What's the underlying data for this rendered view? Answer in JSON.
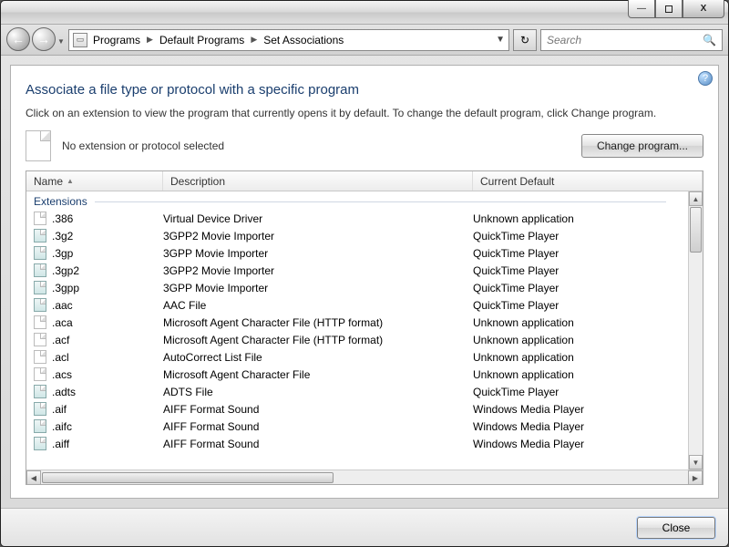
{
  "titlebar": {
    "min": "—",
    "max": "",
    "close": "X"
  },
  "nav": {
    "crumbs": [
      "Programs",
      "Default Programs",
      "Set Associations"
    ],
    "search_placeholder": "Search"
  },
  "page": {
    "heading": "Associate a file type or protocol with a specific program",
    "instruction": "Click on an extension to view the program that currently opens it by default. To change the default program, click Change program.",
    "no_selection": "No extension or protocol selected",
    "change_btn": "Change program...",
    "help": "?"
  },
  "columns": {
    "name": "Name",
    "desc": "Description",
    "def": "Current Default"
  },
  "group_label": "Extensions",
  "rows": [
    {
      "ext": ".386",
      "desc": "Virtual Device Driver",
      "def": "Unknown application",
      "media": false
    },
    {
      "ext": ".3g2",
      "desc": "3GPP2 Movie Importer",
      "def": "QuickTime Player",
      "media": true
    },
    {
      "ext": ".3gp",
      "desc": "3GPP Movie Importer",
      "def": "QuickTime Player",
      "media": true
    },
    {
      "ext": ".3gp2",
      "desc": "3GPP2 Movie Importer",
      "def": "QuickTime Player",
      "media": true
    },
    {
      "ext": ".3gpp",
      "desc": "3GPP Movie Importer",
      "def": "QuickTime Player",
      "media": true
    },
    {
      "ext": ".aac",
      "desc": "AAC File",
      "def": "QuickTime Player",
      "media": true
    },
    {
      "ext": ".aca",
      "desc": "Microsoft Agent Character File (HTTP format)",
      "def": "Unknown application",
      "media": false
    },
    {
      "ext": ".acf",
      "desc": "Microsoft Agent Character File (HTTP format)",
      "def": "Unknown application",
      "media": false
    },
    {
      "ext": ".acl",
      "desc": "AutoCorrect List File",
      "def": "Unknown application",
      "media": false
    },
    {
      "ext": ".acs",
      "desc": "Microsoft Agent Character File",
      "def": "Unknown application",
      "media": false
    },
    {
      "ext": ".adts",
      "desc": "ADTS File",
      "def": "QuickTime Player",
      "media": true
    },
    {
      "ext": ".aif",
      "desc": "AIFF Format Sound",
      "def": "Windows Media Player",
      "media": true
    },
    {
      "ext": ".aifc",
      "desc": "AIFF Format Sound",
      "def": "Windows Media Player",
      "media": true
    },
    {
      "ext": ".aiff",
      "desc": "AIFF Format Sound",
      "def": "Windows Media Player",
      "media": true
    }
  ],
  "footer": {
    "close": "Close"
  }
}
